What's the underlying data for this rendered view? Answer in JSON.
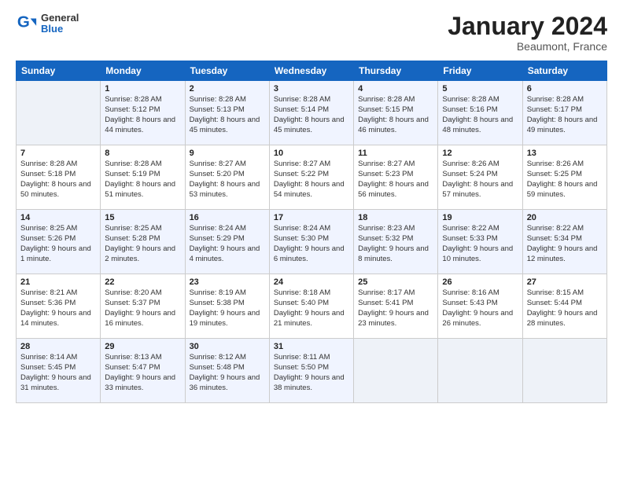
{
  "header": {
    "logo_general": "General",
    "logo_blue": "Blue",
    "month_title": "January 2024",
    "location": "Beaumont, France"
  },
  "weekdays": [
    "Sunday",
    "Monday",
    "Tuesday",
    "Wednesday",
    "Thursday",
    "Friday",
    "Saturday"
  ],
  "weeks": [
    [
      {
        "day": "",
        "empty": true
      },
      {
        "day": "1",
        "sunrise": "Sunrise: 8:28 AM",
        "sunset": "Sunset: 5:12 PM",
        "daylight": "Daylight: 8 hours and 44 minutes."
      },
      {
        "day": "2",
        "sunrise": "Sunrise: 8:28 AM",
        "sunset": "Sunset: 5:13 PM",
        "daylight": "Daylight: 8 hours and 45 minutes."
      },
      {
        "day": "3",
        "sunrise": "Sunrise: 8:28 AM",
        "sunset": "Sunset: 5:14 PM",
        "daylight": "Daylight: 8 hours and 45 minutes."
      },
      {
        "day": "4",
        "sunrise": "Sunrise: 8:28 AM",
        "sunset": "Sunset: 5:15 PM",
        "daylight": "Daylight: 8 hours and 46 minutes."
      },
      {
        "day": "5",
        "sunrise": "Sunrise: 8:28 AM",
        "sunset": "Sunset: 5:16 PM",
        "daylight": "Daylight: 8 hours and 48 minutes."
      },
      {
        "day": "6",
        "sunrise": "Sunrise: 8:28 AM",
        "sunset": "Sunset: 5:17 PM",
        "daylight": "Daylight: 8 hours and 49 minutes."
      }
    ],
    [
      {
        "day": "7",
        "sunrise": "Sunrise: 8:28 AM",
        "sunset": "Sunset: 5:18 PM",
        "daylight": "Daylight: 8 hours and 50 minutes."
      },
      {
        "day": "8",
        "sunrise": "Sunrise: 8:28 AM",
        "sunset": "Sunset: 5:19 PM",
        "daylight": "Daylight: 8 hours and 51 minutes."
      },
      {
        "day": "9",
        "sunrise": "Sunrise: 8:27 AM",
        "sunset": "Sunset: 5:20 PM",
        "daylight": "Daylight: 8 hours and 53 minutes."
      },
      {
        "day": "10",
        "sunrise": "Sunrise: 8:27 AM",
        "sunset": "Sunset: 5:22 PM",
        "daylight": "Daylight: 8 hours and 54 minutes."
      },
      {
        "day": "11",
        "sunrise": "Sunrise: 8:27 AM",
        "sunset": "Sunset: 5:23 PM",
        "daylight": "Daylight: 8 hours and 56 minutes."
      },
      {
        "day": "12",
        "sunrise": "Sunrise: 8:26 AM",
        "sunset": "Sunset: 5:24 PM",
        "daylight": "Daylight: 8 hours and 57 minutes."
      },
      {
        "day": "13",
        "sunrise": "Sunrise: 8:26 AM",
        "sunset": "Sunset: 5:25 PM",
        "daylight": "Daylight: 8 hours and 59 minutes."
      }
    ],
    [
      {
        "day": "14",
        "sunrise": "Sunrise: 8:25 AM",
        "sunset": "Sunset: 5:26 PM",
        "daylight": "Daylight: 9 hours and 1 minute."
      },
      {
        "day": "15",
        "sunrise": "Sunrise: 8:25 AM",
        "sunset": "Sunset: 5:28 PM",
        "daylight": "Daylight: 9 hours and 2 minutes."
      },
      {
        "day": "16",
        "sunrise": "Sunrise: 8:24 AM",
        "sunset": "Sunset: 5:29 PM",
        "daylight": "Daylight: 9 hours and 4 minutes."
      },
      {
        "day": "17",
        "sunrise": "Sunrise: 8:24 AM",
        "sunset": "Sunset: 5:30 PM",
        "daylight": "Daylight: 9 hours and 6 minutes."
      },
      {
        "day": "18",
        "sunrise": "Sunrise: 8:23 AM",
        "sunset": "Sunset: 5:32 PM",
        "daylight": "Daylight: 9 hours and 8 minutes."
      },
      {
        "day": "19",
        "sunrise": "Sunrise: 8:22 AM",
        "sunset": "Sunset: 5:33 PM",
        "daylight": "Daylight: 9 hours and 10 minutes."
      },
      {
        "day": "20",
        "sunrise": "Sunrise: 8:22 AM",
        "sunset": "Sunset: 5:34 PM",
        "daylight": "Daylight: 9 hours and 12 minutes."
      }
    ],
    [
      {
        "day": "21",
        "sunrise": "Sunrise: 8:21 AM",
        "sunset": "Sunset: 5:36 PM",
        "daylight": "Daylight: 9 hours and 14 minutes."
      },
      {
        "day": "22",
        "sunrise": "Sunrise: 8:20 AM",
        "sunset": "Sunset: 5:37 PM",
        "daylight": "Daylight: 9 hours and 16 minutes."
      },
      {
        "day": "23",
        "sunrise": "Sunrise: 8:19 AM",
        "sunset": "Sunset: 5:38 PM",
        "daylight": "Daylight: 9 hours and 19 minutes."
      },
      {
        "day": "24",
        "sunrise": "Sunrise: 8:18 AM",
        "sunset": "Sunset: 5:40 PM",
        "daylight": "Daylight: 9 hours and 21 minutes."
      },
      {
        "day": "25",
        "sunrise": "Sunrise: 8:17 AM",
        "sunset": "Sunset: 5:41 PM",
        "daylight": "Daylight: 9 hours and 23 minutes."
      },
      {
        "day": "26",
        "sunrise": "Sunrise: 8:16 AM",
        "sunset": "Sunset: 5:43 PM",
        "daylight": "Daylight: 9 hours and 26 minutes."
      },
      {
        "day": "27",
        "sunrise": "Sunrise: 8:15 AM",
        "sunset": "Sunset: 5:44 PM",
        "daylight": "Daylight: 9 hours and 28 minutes."
      }
    ],
    [
      {
        "day": "28",
        "sunrise": "Sunrise: 8:14 AM",
        "sunset": "Sunset: 5:45 PM",
        "daylight": "Daylight: 9 hours and 31 minutes."
      },
      {
        "day": "29",
        "sunrise": "Sunrise: 8:13 AM",
        "sunset": "Sunset: 5:47 PM",
        "daylight": "Daylight: 9 hours and 33 minutes."
      },
      {
        "day": "30",
        "sunrise": "Sunrise: 8:12 AM",
        "sunset": "Sunset: 5:48 PM",
        "daylight": "Daylight: 9 hours and 36 minutes."
      },
      {
        "day": "31",
        "sunrise": "Sunrise: 8:11 AM",
        "sunset": "Sunset: 5:50 PM",
        "daylight": "Daylight: 9 hours and 38 minutes."
      },
      {
        "day": "",
        "empty": true
      },
      {
        "day": "",
        "empty": true
      },
      {
        "day": "",
        "empty": true
      }
    ]
  ]
}
